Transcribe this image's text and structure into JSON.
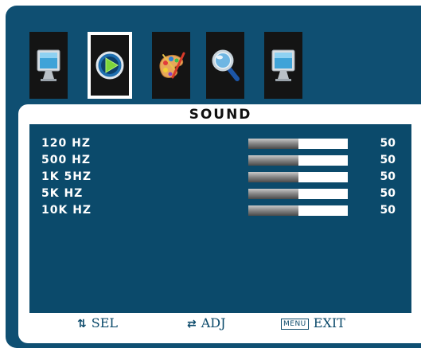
{
  "menu": {
    "tabs": [
      {
        "icon": "monitor-icon",
        "selected": false
      },
      {
        "icon": "sound-play-icon",
        "selected": true
      },
      {
        "icon": "palette-icon",
        "selected": false
      },
      {
        "icon": "magnifier-icon",
        "selected": false
      },
      {
        "icon": "monitor-settings-icon",
        "selected": false
      }
    ],
    "title": "SOUND",
    "items": [
      {
        "label": "120 HZ",
        "value": "50",
        "level": 0.5
      },
      {
        "label": "500 HZ",
        "value": "50",
        "level": 0.5
      },
      {
        "label": "1K 5HZ",
        "value": "50",
        "level": 0.5
      },
      {
        "label": "5K HZ",
        "value": "50",
        "level": 0.5
      },
      {
        "label": "10K HZ",
        "value": "50",
        "level": 0.5
      }
    ],
    "footer": {
      "sel_glyph": "⇅",
      "sel_label": "SEL",
      "adj_glyph": "⇄",
      "adj_label": "ADJ",
      "menu_key": "MENU",
      "exit_label": "EXIT"
    },
    "colors": {
      "osd_background": "#0f4f72",
      "list_background": "#0b4a6b",
      "panel": "#ffffff"
    }
  }
}
